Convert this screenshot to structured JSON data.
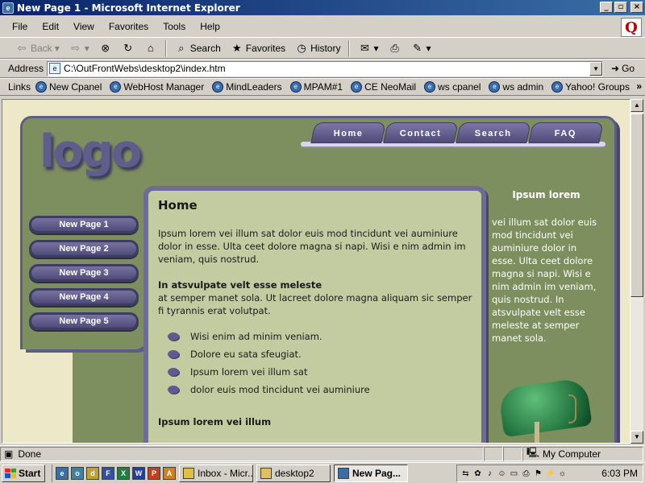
{
  "window": {
    "title": "New Page 1 - Microsoft Internet Explorer",
    "minimize": "_",
    "maximize": "▫",
    "close": "×"
  },
  "menubar": {
    "items": [
      "File",
      "Edit",
      "View",
      "Favorites",
      "Tools",
      "Help"
    ]
  },
  "toolbar": {
    "back": "Back",
    "search": "Search",
    "favorites": "Favorites",
    "history": "History"
  },
  "address": {
    "label": "Address",
    "value": "C:\\OutFrontWebs\\desktop2\\index.htm",
    "go": "Go"
  },
  "links": {
    "label": "Links",
    "more": "»",
    "items": [
      "New Cpanel",
      "WebHost Manager",
      "MindLeaders",
      "MPAM#1",
      "CE NeoMail",
      "ws cpanel",
      "ws admin",
      "Yahoo! Groups"
    ]
  },
  "site": {
    "logo": "logo",
    "tabs": [
      "Home",
      "Contact",
      "Search",
      "FAQ"
    ],
    "nav": [
      "New Page 1",
      "New Page 2",
      "New Page 3",
      "New Page 4",
      "New Page 5"
    ],
    "main": {
      "heading": "Home",
      "para1": "Ipsum lorem vei illum sat dolor euis mod tincidunt vei auminiure dolor in esse. Ulta ceet dolore magna si napi. Wisi e nim admin im veniam, quis nostrud.",
      "subheading": "In atsvulpate velt esse meleste",
      "para2": "at semper manet sola. Ut lacreet dolore magna aliquam sic semper fi tyrannis erat volutpat.",
      "bullets": [
        "Wisi enim ad minim veniam.",
        "Dolore eu sata sfeugiat.",
        "Ipsum lorem vei illum sat",
        "dolor euis mod tincidunt vei auminiure"
      ],
      "subheading2": "Ipsum lorem vei illum"
    },
    "sidebar": {
      "heading": "Ipsum lorem",
      "text": "vei illum sat dolor euis mod tincidunt vei auminiure dolor in esse. Ulta ceet dolore magna si napi. Wisi e nim admin im veniam, quis nostrud. In atsvulpate velt esse meleste at semper manet sola."
    }
  },
  "status": {
    "text": "Done",
    "zone": "My Computer"
  },
  "taskbar": {
    "start": "Start",
    "tasks": [
      "Inbox - Micr...",
      "desktop2",
      "New Pag..."
    ],
    "clock": "6:03 PM"
  },
  "colors": {
    "site_green": "#7d8f5e",
    "site_purple": "#5f5d8c",
    "content_bg": "#c2cca0",
    "page_bg": "#ece8c8"
  }
}
